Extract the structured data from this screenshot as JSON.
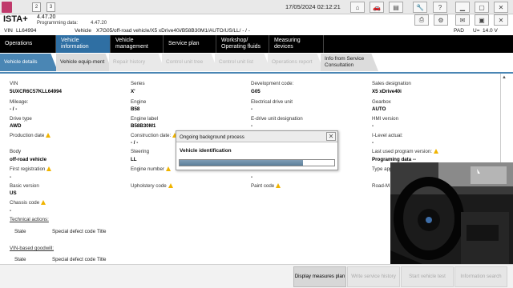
{
  "titlebar": {
    "tab_numbers": [
      "2",
      "3"
    ],
    "datetime": "17/05/2024 02:12:21",
    "icons": [
      "home-icon",
      "car-icon",
      "book-icon",
      "wrench-icon",
      "help-icon",
      "minimize-icon",
      "maximize-icon",
      "close-icon"
    ]
  },
  "app": {
    "name": "ISTA+",
    "version": "4.47.20",
    "programming_data_label": "Programming data:",
    "programming_data_value": "4.47.20"
  },
  "vin_row": {
    "vin_label": "VIN",
    "vin_value": "LL64994",
    "vehicle_label": "Vehicle",
    "vehicle_value": "X7G05/off-road vehicle/X5 xDrive40i/B58B30M1/AUTO/US/LL/ - / -",
    "pad_label": "PAD",
    "voltage_label": "U=",
    "voltage_value": "14.0 V"
  },
  "main_tabs": [
    "Operations",
    "Vehicle information",
    "Vehicle management",
    "Service plan",
    "Workshop/ Operating fluids",
    "Measuring devices"
  ],
  "sub_tabs": [
    "Vehicle details",
    "Vehicle equip-ment",
    "Repair history",
    "Control unit tree",
    "Control unit list",
    "Operations report",
    "Info from Service Consultation"
  ],
  "details": {
    "col1": [
      {
        "label": "VIN",
        "value": "5UXCR6C57KLL64994"
      },
      {
        "label": "Mileage:",
        "value": "- / -"
      },
      {
        "label": "Drive type",
        "value": "AWD"
      },
      {
        "label": "Production date",
        "value": ""
      },
      {
        "label": "Body",
        "value": "off-road vehicle"
      },
      {
        "label": "First registration",
        "value": "-"
      },
      {
        "label": "Basic version",
        "value": "US"
      },
      {
        "label": "Chassis code",
        "value": "-"
      }
    ],
    "col2": [
      {
        "label": "Series",
        "value": "X'"
      },
      {
        "label": "Engine",
        "value": "B58"
      },
      {
        "label": "Engine label",
        "value": "B58B30M1"
      },
      {
        "label": "Construction date:",
        "value": "- / -"
      },
      {
        "label": "Steering",
        "value": "LL"
      },
      {
        "label": "Engine number",
        "value": ""
      },
      {
        "label": "Upholstery code",
        "value": ""
      }
    ],
    "col3": [
      {
        "label": "Development code:",
        "value": "G05"
      },
      {
        "label": "Electrical drive unit",
        "value": "-"
      },
      {
        "label": "E-drive unit designation",
        "value": "-"
      },
      {
        "label": "",
        "value": ""
      },
      {
        "label": "",
        "value": ""
      },
      {
        "label": "",
        "value": "-"
      },
      {
        "label": "Paint code",
        "value": ""
      }
    ],
    "col4": [
      {
        "label": "Sales designation",
        "value": "X5 xDrive40i"
      },
      {
        "label": "Gearbox",
        "value": "AUTO"
      },
      {
        "label": "HMI version",
        "value": "-"
      },
      {
        "label": "I-Level actual:",
        "value": "-"
      },
      {
        "label": "Last used program version:",
        "value": "Programing data --"
      },
      {
        "label": "Type app",
        "value": ""
      },
      {
        "label": "Road-M",
        "value": ""
      }
    ]
  },
  "technical_actions": {
    "title": "Technical actions:",
    "headers": [
      "State",
      "Special defect code",
      "Title"
    ]
  },
  "vin_goodwill": {
    "title": "VIN-based goodwill:",
    "headers": [
      "State",
      "Special defect code",
      "Title"
    ]
  },
  "dialog": {
    "title": "Ongoing background process",
    "label": "Vehicle identification",
    "progress": 0.8
  },
  "bottom_buttons": [
    "Display measures plan",
    "Write service history",
    "Start vehicle test",
    "Information search"
  ],
  "colors": {
    "accent": "#4a86b4",
    "active_main_tab": "#2f6fa3",
    "warning": "#f0b400"
  }
}
